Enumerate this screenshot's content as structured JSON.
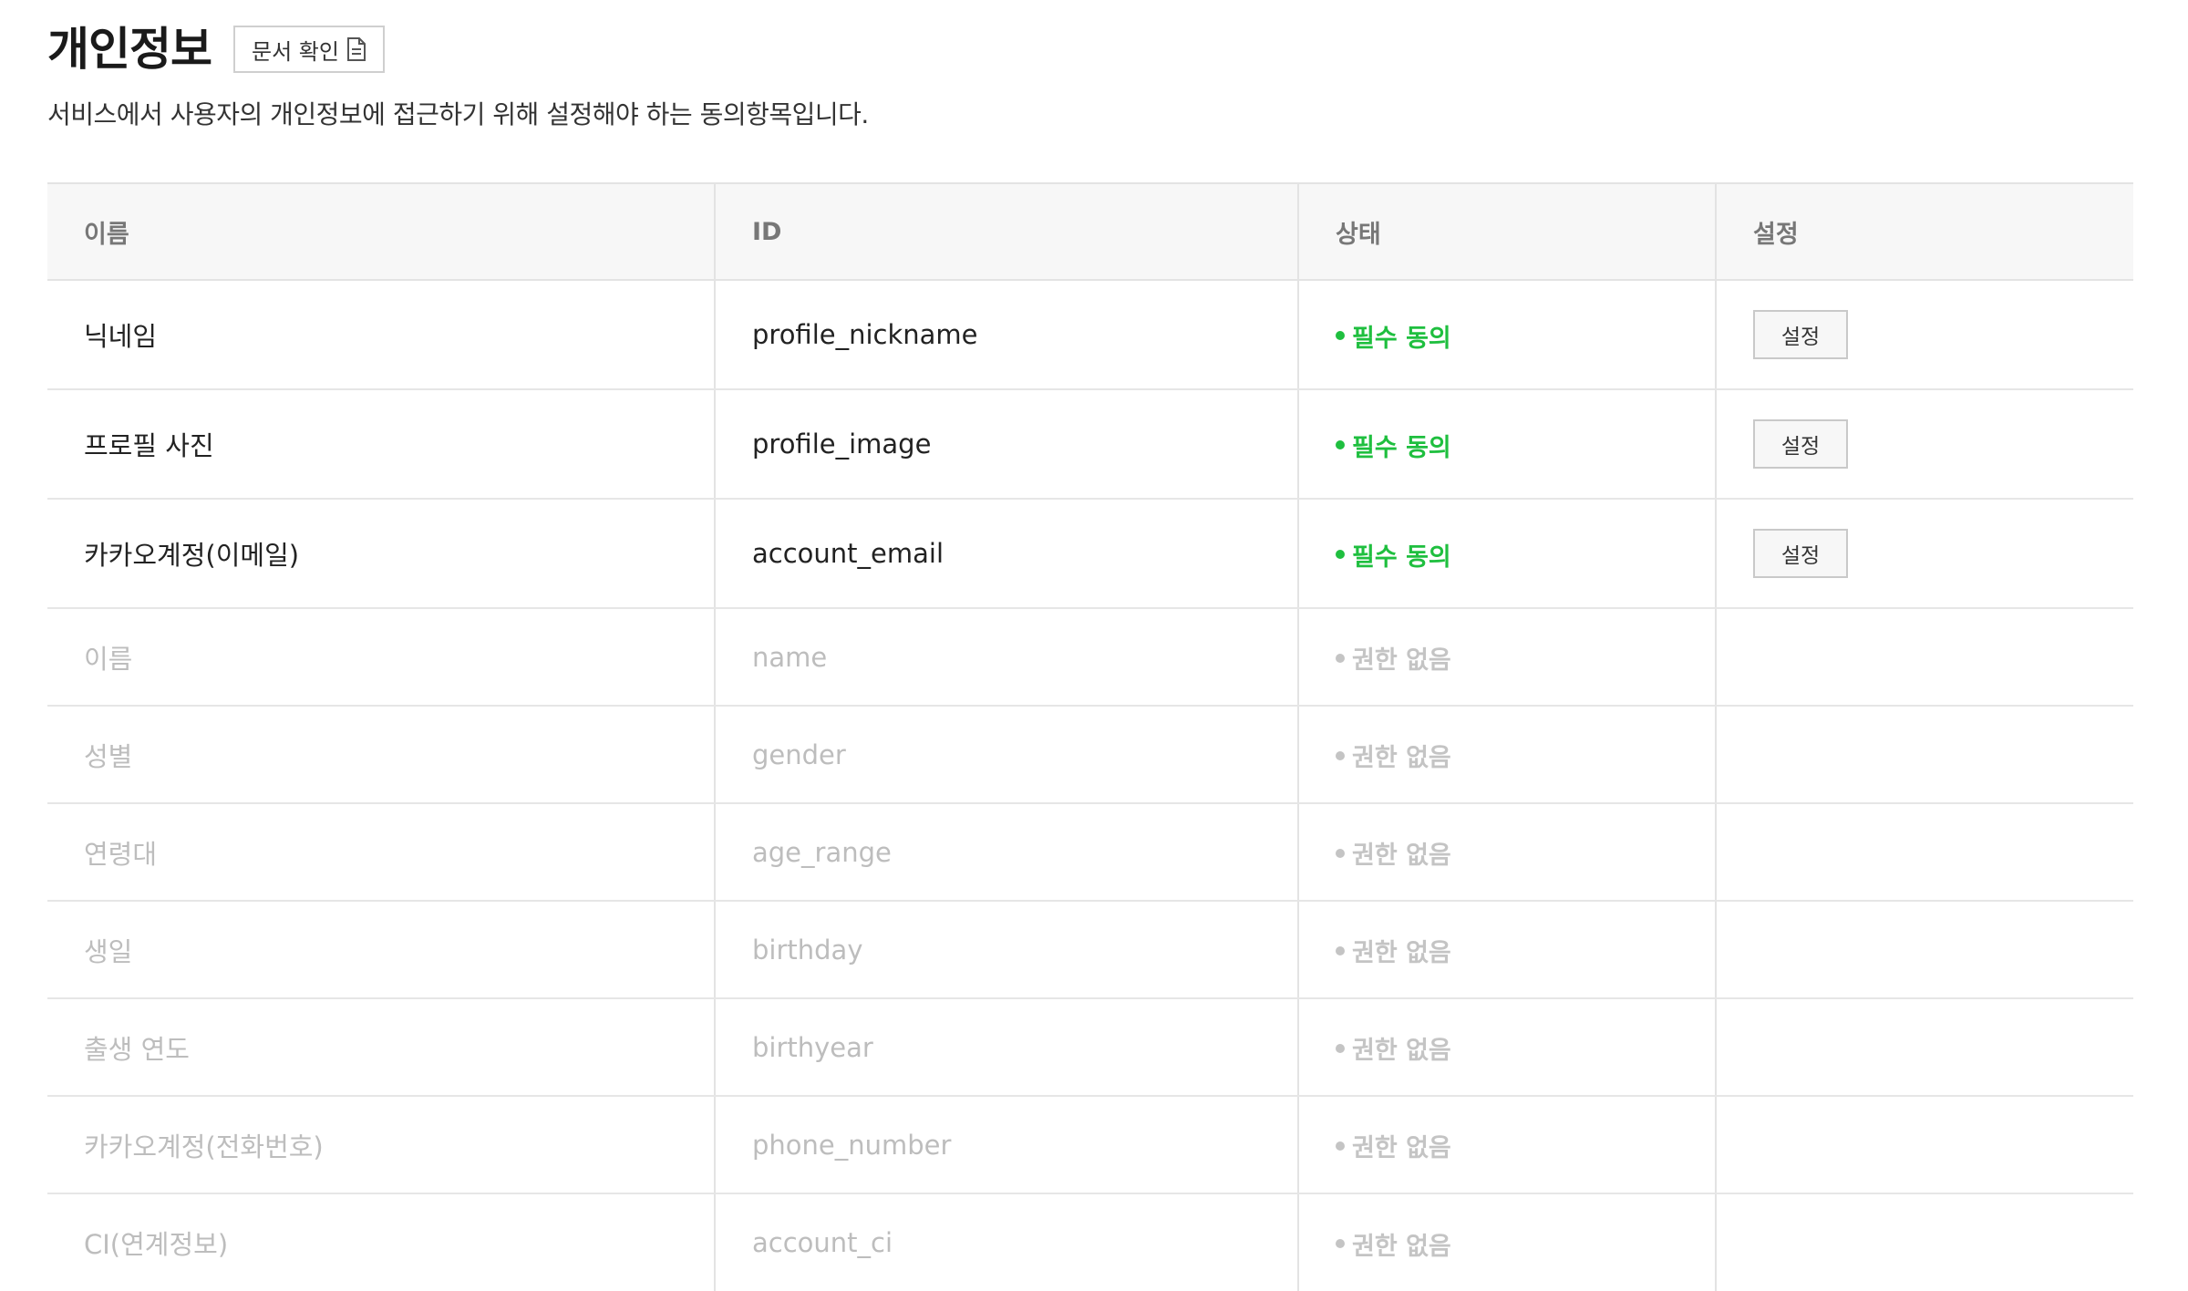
{
  "header": {
    "title": "개인정보",
    "doc_button_label": "문서 확인",
    "doc_icon": "document-icon"
  },
  "description": "서비스에서 사용자의 개인정보에 접근하기 위해 설정해야 하는 동의항목입니다.",
  "table": {
    "columns": [
      "이름",
      "ID",
      "상태",
      "설정"
    ],
    "rows": [
      {
        "name": "닉네임",
        "id": "profile_nickname",
        "status": "필수 동의",
        "action": "설정"
      },
      {
        "name": "프로필 사진",
        "id": "profile_image",
        "status": "필수 동의",
        "action": "설정"
      },
      {
        "name": "카카오계정(이메일)",
        "id": "account_email",
        "status": "필수 동의",
        "action": "설정"
      },
      {
        "name": "이름",
        "id": "name",
        "status": "권한 없음"
      },
      {
        "name": "성별",
        "id": "gender",
        "status": "권한 없음"
      },
      {
        "name": "연령대",
        "id": "age_range",
        "status": "권한 없음"
      },
      {
        "name": "생일",
        "id": "birthday",
        "status": "권한 없음"
      },
      {
        "name": "출생 연도",
        "id": "birthyear",
        "status": "권한 없음"
      },
      {
        "name": "카카오계정(전화번호)",
        "id": "phone_number",
        "status": "권한 없음"
      },
      {
        "name": "CI(연계정보)",
        "id": "account_ci",
        "status": "권한 없음"
      }
    ]
  },
  "colors": {
    "required": "#1fbf3f",
    "disabled_text": "#bdbdbd",
    "header_bg": "#f7f7f7",
    "border": "#e3e3e3"
  }
}
